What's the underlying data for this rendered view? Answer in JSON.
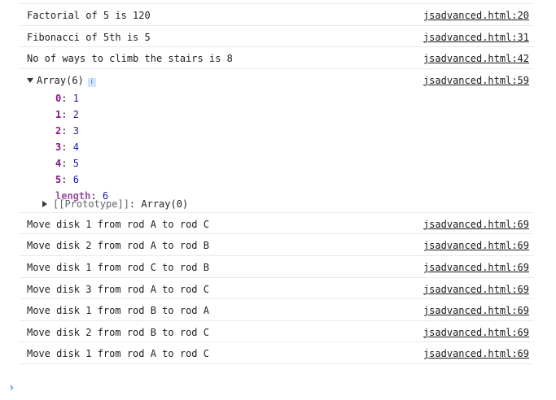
{
  "logs_top": [
    {
      "message": "Factorial of 5 is 120",
      "source": "jsadvanced.html:20"
    },
    {
      "message": "Fibonacci of 5th is 5",
      "source": "jsadvanced.html:31"
    },
    {
      "message": "No of ways to climb the stairs is 8",
      "source": "jsadvanced.html:42"
    }
  ],
  "array_log": {
    "header": "Array(6)",
    "info_badge": "i",
    "source": "jsadvanced.html:59",
    "items": [
      {
        "key": "0",
        "value": "1"
      },
      {
        "key": "1",
        "value": "2"
      },
      {
        "key": "2",
        "value": "3"
      },
      {
        "key": "3",
        "value": "4"
      },
      {
        "key": "4",
        "value": "5"
      },
      {
        "key": "5",
        "value": "6"
      }
    ],
    "length_key": "length",
    "length_value": "6",
    "prototype_key": "[[Prototype]]",
    "prototype_value": "Array(0)"
  },
  "logs_bottom": [
    {
      "message": "Move disk 1 from rod A to rod C",
      "source": "jsadvanced.html:69"
    },
    {
      "message": "Move disk 2 from rod A to rod B",
      "source": "jsadvanced.html:69"
    },
    {
      "message": "Move disk 1 from rod C to rod B",
      "source": "jsadvanced.html:69"
    },
    {
      "message": "Move disk 3 from rod A to rod C",
      "source": "jsadvanced.html:69"
    },
    {
      "message": "Move disk 1 from rod B to rod A",
      "source": "jsadvanced.html:69"
    },
    {
      "message": "Move disk 2 from rod B to rod C",
      "source": "jsadvanced.html:69"
    },
    {
      "message": "Move disk 1 from rod A to rod C",
      "source": "jsadvanced.html:69"
    }
  ],
  "prompt": {
    "icon": "chevron-right-icon",
    "symbol": "›"
  },
  "colors": {
    "link": "#1a1a1a",
    "key": "#881280",
    "number": "#1a1aa6",
    "prompt": "#1a73e8"
  }
}
